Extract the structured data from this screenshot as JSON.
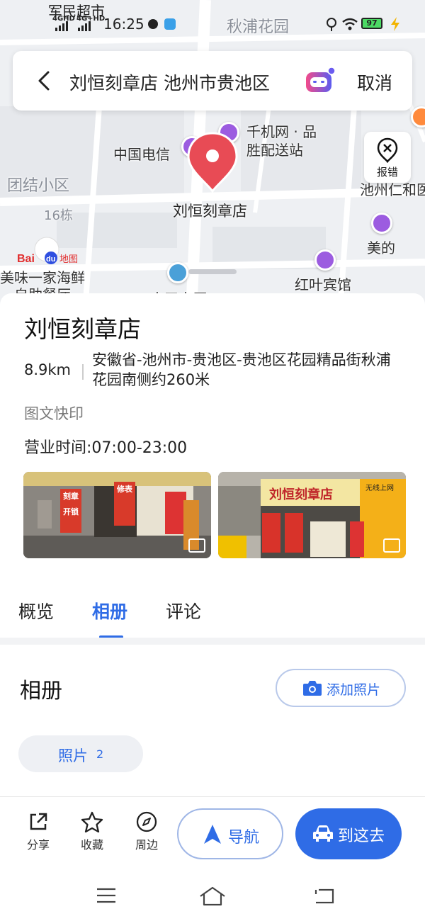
{
  "status_bar": {
    "carrier": "军民超市",
    "time": "16:25",
    "net1": "4GHD",
    "net2": "4G+HD",
    "battery": "97"
  },
  "map": {
    "labels": {
      "qiupu_garden": "秋浦花园",
      "tuanjie": "团结小区",
      "bld16": "16栋",
      "china_telecom": "中国电信",
      "qianji_1": "千机网 · 品",
      "qianji_2": "胜配送站",
      "shop": "刘恒刻章店",
      "meiwei_1": "美味一家海鲜",
      "meiwei_2": "自助餐厅",
      "zhongtian": "中天大厦",
      "hongye": "红叶宾馆",
      "meide": "美的",
      "chizhou_he": "池州仁和医"
    },
    "baidu_logo": "Baidu地图",
    "report_label": "报错"
  },
  "search": {
    "query": "刘恒刻章店 池州市贵池区",
    "cancel": "取消"
  },
  "poi": {
    "name": "刘恒刻章店",
    "distance": "8.9km",
    "address": "安徽省-池州市-贵池区-贵池区花园精品街秋浦花园南侧约260米",
    "category": "图文快印",
    "hours": "营业时间:07:00-23:00"
  },
  "photos": {
    "sign1_l1": "刻章",
    "sign1_l2": "开锁",
    "sign1_l3": "修表",
    "sign2_title": "刘恒刻章店",
    "sign2_sub": "无线上网"
  },
  "tabs": [
    {
      "label": "概览"
    },
    {
      "label": "相册"
    },
    {
      "label": "评论"
    }
  ],
  "album": {
    "title": "相册",
    "add_photo": "添加照片",
    "chip_label": "照片",
    "chip_count": "2"
  },
  "actions": {
    "share": "分享",
    "favorite": "收藏",
    "nearby": "周边",
    "navigate": "导航",
    "go_here": "到这去"
  },
  "colors": {
    "accent": "#2f6ce6",
    "pin": "#e84b55",
    "poi_purple": "#9c5ce0"
  }
}
